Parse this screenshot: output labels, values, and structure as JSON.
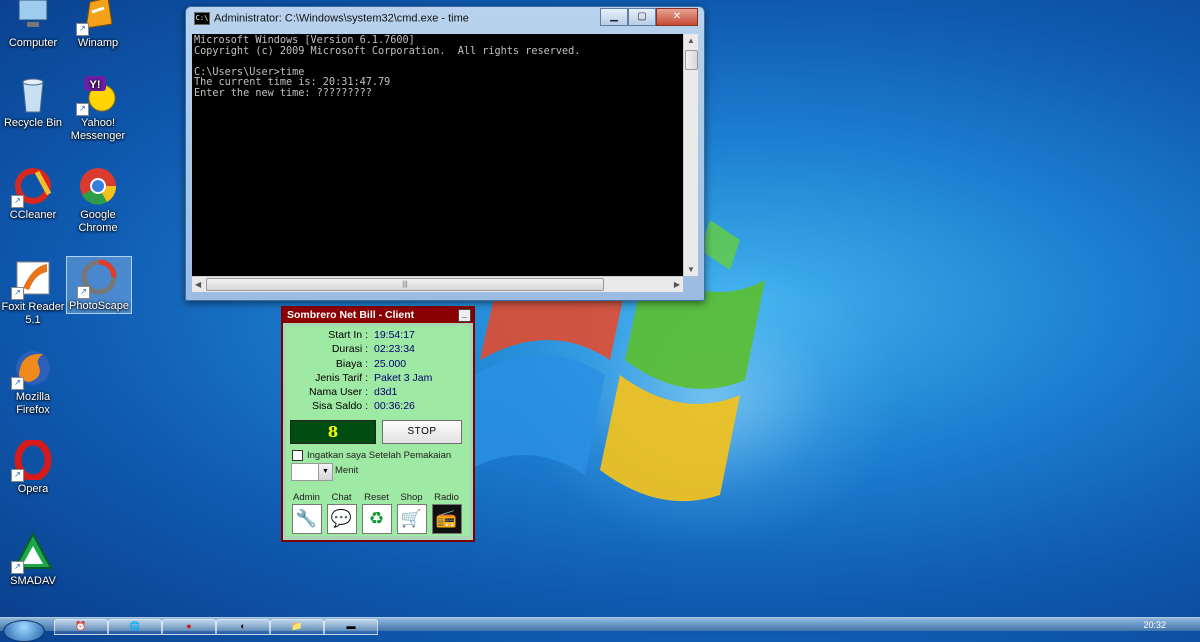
{
  "desktop": {
    "icons": [
      {
        "label": "Computer",
        "icon": "computer-icon"
      },
      {
        "label": "Winamp",
        "icon": "winamp-icon"
      },
      {
        "label": "Recycle Bin",
        "icon": "recycle-bin-icon"
      },
      {
        "label": "Yahoo! Messenger",
        "icon": "yahoo-messenger-icon"
      },
      {
        "label": "CCleaner",
        "icon": "ccleaner-icon"
      },
      {
        "label": "Google Chrome",
        "icon": "chrome-icon"
      },
      {
        "label": "Foxit Reader 5.1",
        "icon": "foxit-reader-icon"
      },
      {
        "label": "PhotoScape",
        "icon": "photoscape-icon"
      },
      {
        "label": "Mozilla Firefox",
        "icon": "firefox-icon"
      },
      {
        "label": "Opera",
        "icon": "opera-icon"
      },
      {
        "label": "SMADAV",
        "icon": "smadav-icon"
      }
    ]
  },
  "cmd_window": {
    "title": "Administrator: C:\\Windows\\system32\\cmd.exe - time",
    "system_icon": "C:\\",
    "lines": [
      "Microsoft Windows [Version 6.1.7600]",
      "Copyright (c) 2009 Microsoft Corporation.  All rights reserved.",
      "",
      "C:\\Users\\User>time",
      "The current time is: 20:31:47.79",
      "Enter the new time: ?????????"
    ],
    "minimize_label": "▁",
    "maximize_label": "▢",
    "close_label": "✕"
  },
  "sombrero": {
    "title": "Sombrero Net Bill - Client",
    "minimize_label": "_",
    "fields": [
      {
        "key": "Start In",
        "value": "19:54:17"
      },
      {
        "key": "Durasi",
        "value": "02:23:34"
      },
      {
        "key": "Biaya",
        "value": "25.000"
      },
      {
        "key": "Jenis Tarif",
        "value": "Paket 3 Jam"
      },
      {
        "key": "Nama User",
        "value": "d3d1"
      },
      {
        "key": "Sisa Saldo",
        "value": "00:36:26"
      }
    ],
    "counter": "8",
    "stop_label": "STOP",
    "checkbox_label": "Ingatkan saya Setelah Pemakaian",
    "menit_label": "Menit",
    "tools": [
      {
        "label": "Admin",
        "icon": "wrench-icon",
        "glyph": "🔧"
      },
      {
        "label": "Chat",
        "icon": "chat-icon",
        "glyph": "💬"
      },
      {
        "label": "Reset",
        "icon": "reset-icon",
        "glyph": "♻"
      },
      {
        "label": "Shop",
        "icon": "cart-icon",
        "glyph": "🛒"
      },
      {
        "label": "Radio",
        "icon": "radio-icon",
        "glyph": "📻"
      }
    ]
  },
  "taskbar": {
    "clock": "20:32"
  }
}
